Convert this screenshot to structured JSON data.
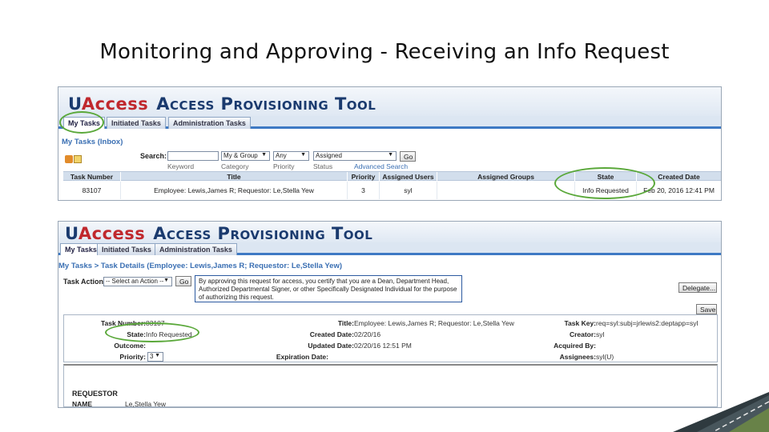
{
  "slide": {
    "title": "Monitoring and Approving - Receiving an Info Request"
  },
  "app": {
    "logo_u": "U",
    "logo_access": "Access",
    "logo_tool": "Access Provisioning Tool"
  },
  "shot1": {
    "tabs": [
      "My Tasks",
      "Initiated Tasks",
      "Administration Tasks"
    ],
    "section_title": "My Tasks (Inbox)",
    "search": {
      "label": "Search:",
      "keyword_value": "",
      "category_value": "My & Group",
      "priority_value": "Any",
      "status_value": "Assigned",
      "go_label": "Go",
      "sub_labels": [
        "Keyword",
        "Category",
        "Priority",
        "Status",
        "Advanced Search"
      ]
    },
    "table": {
      "headers": [
        "Task Number",
        "Title",
        "Priority",
        "Assigned Users",
        "Assigned Groups",
        "State",
        "Created Date"
      ],
      "rows": [
        [
          "83107",
          "Employee: Lewis,James R; Requestor: Le,Stella Yew",
          "3",
          "syl",
          "",
          "Info Requested",
          "Feb 20, 2016 12:41 PM"
        ]
      ]
    }
  },
  "shot2": {
    "tabs": [
      "My Tasks",
      "Initiated Tasks",
      "Administration Tasks"
    ],
    "breadcrumb": "My Tasks > Task Details (Employee: Lewis,James R; Requestor: Le,Stella Yew)",
    "task_action_label": "Task Action:",
    "task_action_value": "-- Select an Action --",
    "go_label": "Go",
    "notice": "By approving this request for access, you certify that you are a Dean, Department Head, Authorized Departmental Signer, or other Specifically Designated Individual for the purpose of authorizing this request.",
    "delegate_label": "Delegate...",
    "save_label": "Save",
    "fields": {
      "task_number_label": "Task Number:",
      "task_number_value": "83107",
      "title_label": "Title:",
      "title_value": "Employee: Lewis,James R; Requestor: Le,Stella Yew",
      "task_key_label": "Task Key:",
      "task_key_value": "req=syl:subj=jrlewis2:deptapp=syl",
      "state_label": "State:",
      "state_value": "Info Requested",
      "created_date_label": "Created Date:",
      "created_date_value": "02/20/16",
      "creator_label": "Creator:",
      "creator_value": "syl",
      "outcome_label": "Outcome:",
      "outcome_value": "",
      "updated_date_label": "Updated Date:",
      "updated_date_value": "02/20/16 12:51 PM",
      "acquired_by_label": "Acquired By:",
      "acquired_by_value": "",
      "priority_label": "Priority:",
      "priority_value": "3",
      "expiration_date_label": "Expiration Date:",
      "expiration_date_value": "",
      "assignees_label": "Assignees:",
      "assignees_value": "syl(U)"
    },
    "requestor": {
      "heading": "REQUESTOR",
      "name_label": "NAME",
      "name_value": "Le,Stella Yew"
    }
  },
  "colors": {
    "accent": "#3a6fb3",
    "highlight_circle": "#5aa83a",
    "logo_red": "#c0282d",
    "logo_navy": "#1a3a6e"
  }
}
